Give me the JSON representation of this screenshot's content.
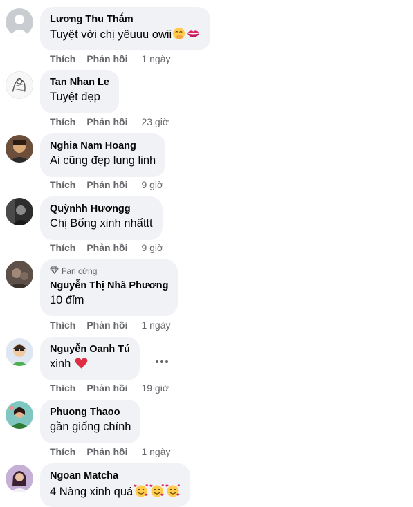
{
  "comments": [
    {
      "name": "Lương Thu Thắm",
      "text": "Tuyệt vời chị yêuuu owii",
      "emojis": [
        "smiling-face-with-hand-over-mouth",
        "kiss-mark"
      ],
      "like": "Thích",
      "reply": "Phản hồi",
      "time": "1 ngày"
    },
    {
      "name": "Tan Nhan Le",
      "text": "Tuyệt đẹp",
      "like": "Thích",
      "reply": "Phản hồi",
      "time": "23 giờ"
    },
    {
      "name": "Nghia Nam Hoang",
      "text": "Ai cũng đẹp lung linh",
      "like": "Thích",
      "reply": "Phản hồi",
      "time": "9 giờ"
    },
    {
      "name": "Quỳnhh Hươngg",
      "text": "Chị Bống xinh nhấttt",
      "like": "Thích",
      "reply": "Phản hồi",
      "time": "9 giờ"
    },
    {
      "badge": "Fan cứng",
      "name": "Nguyễn Thị Nhã Phương",
      "text": "10 đỉm",
      "like": "Thích",
      "reply": "Phản hồi",
      "time": "1 ngày"
    },
    {
      "name": "Nguyễn Oanh Tú",
      "text": "xinh",
      "emojis": [
        "red-heart"
      ],
      "like": "Thích",
      "reply": "Phản hồi",
      "time": "19 giờ"
    },
    {
      "name": "Phuong Thaoo",
      "text": "gần giống chính",
      "like": "Thích",
      "reply": "Phản hồi",
      "time": "1 ngày"
    },
    {
      "name": "Ngoan Matcha",
      "text": "4 Nàng xinh quá",
      "emojis": [
        "smiling-face-with-hearts",
        "smiling-face-with-hearts",
        "smiling-face-with-hearts"
      ]
    }
  ],
  "colors": {
    "bubble": "#f0f2f5",
    "secondary_text": "#65676b",
    "primary_text": "#050505"
  }
}
